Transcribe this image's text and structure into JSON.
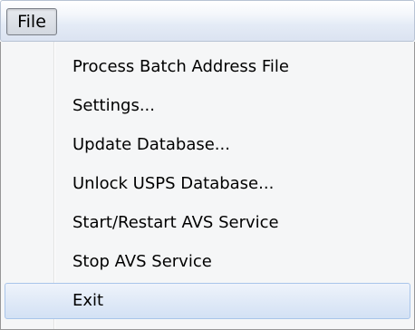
{
  "menubar": {
    "file_label": "File"
  },
  "menu": {
    "items": [
      {
        "label": "Process Batch Address File"
      },
      {
        "label": "Settings..."
      },
      {
        "label": "Update Database..."
      },
      {
        "label": "Unlock USPS Database..."
      },
      {
        "label": "Start/Restart AVS Service"
      },
      {
        "label": "Stop AVS Service"
      },
      {
        "label": "Exit"
      }
    ],
    "highlighted_item": "Exit"
  },
  "colors": {
    "highlight_border": "#a9c5ea",
    "menu_background": "#f5f6f7"
  }
}
